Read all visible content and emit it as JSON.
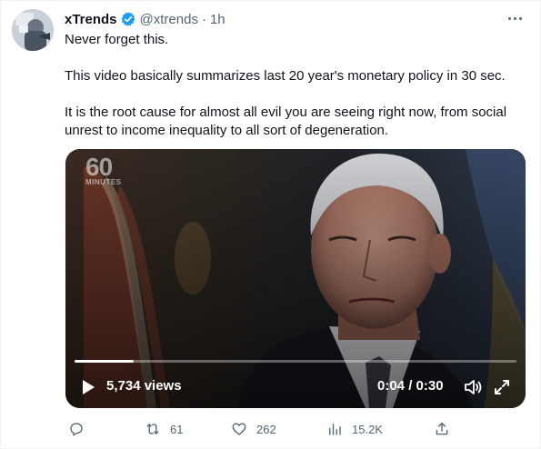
{
  "tweet": {
    "name": "xTrends",
    "handle": "@xtrends",
    "separator": "·",
    "time": "1h",
    "paragraphs": [
      "Never forget this.",
      "This video basically summarizes last 20 year's monetary policy in 30 sec.",
      "It is the root cause for almost all evil you are seeing right now, from social unrest to income inequality to all sort of degeneration."
    ]
  },
  "video": {
    "logo_number": "60",
    "logo_word": "MINUTES",
    "views": "5,734 views",
    "timecode": "0:04 / 0:30",
    "progress": 0.133
  },
  "actions": {
    "replies": "",
    "retweets": "61",
    "likes": "262",
    "views": "15.2K"
  },
  "icons": {
    "verified": "verified-badge-icon",
    "more": "more-dots-icon",
    "play": "play-icon",
    "volume": "volume-icon",
    "fullscreen": "fullscreen-icon",
    "reply": "reply-icon",
    "retweet": "retweet-icon",
    "like": "like-icon",
    "analytics": "analytics-icon",
    "share": "share-icon"
  },
  "colors": {
    "verified": "#1d9bf0",
    "muted": "#536471",
    "text": "#0f1419"
  }
}
